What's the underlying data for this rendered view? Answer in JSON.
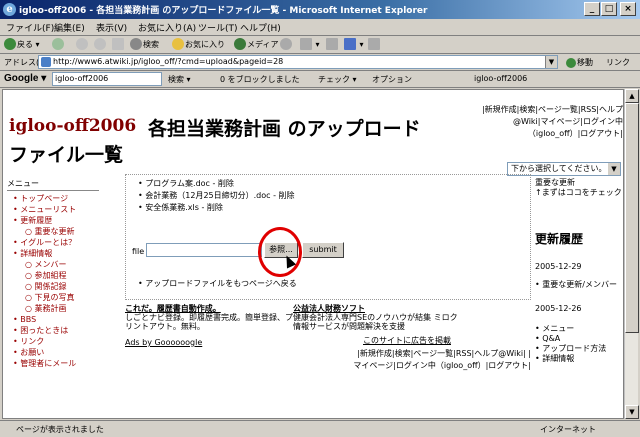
{
  "window": {
    "title": "igloo-off2006 - 各担当業務計画 のアップロードファイル一覧 - Microsoft Internet Explorer"
  },
  "menubar": [
    "ファイル(F)",
    "編集(E)",
    "表示(V)",
    "お気に入り(A)",
    "ツール(T)",
    "ヘルプ(H)"
  ],
  "toolbar": {
    "back": "戻る",
    "search": "検索",
    "favorites": "お気に入り",
    "media": "メディア"
  },
  "address": {
    "label": "アドレス(D)",
    "url": "http://www6.atwiki.jp/igloo_off/?cmd=upload&pageid=28",
    "go": "移動",
    "links": "リンク"
  },
  "google": {
    "logo": "Google",
    "query": "igloo-off2006",
    "search": "検索",
    "blocked": "0 をブロックしました",
    "check": "チェック",
    "options": "オプション",
    "site": "igloo-off2006"
  },
  "page": {
    "site_title": "igloo-off2006",
    "title_line1": "各担当業務計画 のアップロード",
    "title_line2": "ファイル一覧",
    "right_links": "|新規作成|検索|ページ一覧|RSS|ヘルプ@Wiki|マイページ|ログイン中（igloo_off）|ログアウト|",
    "select_label": "下から選択してください。"
  },
  "menu": {
    "head": "メニュー",
    "items": [
      "トップページ",
      "メニューリスト",
      "更新履歴"
    ],
    "sub1": [
      "重要な更新"
    ],
    "items2": [
      "イグルーとは？",
      "詳細情報"
    ],
    "sub2": [
      "メンバー",
      "参加組程",
      "関係記録",
      "下見の写真",
      "業務計画"
    ],
    "items3": [
      "BBS",
      "困ったときは",
      "リンク",
      "お願い",
      "管理者にメール"
    ]
  },
  "files": [
    "プログラム案.doc - 削除",
    "会計業務（12月25日締切分）.doc - 削除",
    "安全係業務.xls - 削除"
  ],
  "upload": {
    "file_label": "file",
    "browse": "参照...",
    "submit": "submit",
    "link": "アップロードファイルをもつページへ戻る"
  },
  "ads": [
    {
      "title": "これだ。履歴書自動作成。",
      "body": "しごとナビ登録。即履歴書完成。簡単登録、プリントアウト。無料。"
    },
    {
      "title": "公益法人財務ソフト",
      "body": "健康会計法人専門SEのノウハウが結集 ミロク情報サービスが問題解決を支援"
    }
  ],
  "ad_notice": "このサイトに広告を掲載",
  "ad_by": "Ads by Goooooogle",
  "footer_links": "|新規作成|検索|ページ一覧|RSS|ヘルプ@Wiki| |マイページ|ログイン中（igloo_off）|ログアウト|",
  "rside": {
    "top": "重要な更新",
    "sub": "↑まずはココをチェック",
    "head": "更新履歴",
    "date1": "2005-12-29",
    "list1": [
      "重要な更新/メンバー"
    ],
    "date2": "2005-12-26",
    "list2": [
      "メニュー",
      "Q&A",
      "アップロード方法",
      "詳細情報"
    ]
  },
  "status": {
    "text": "ページが表示されました",
    "zone": "インターネット"
  }
}
